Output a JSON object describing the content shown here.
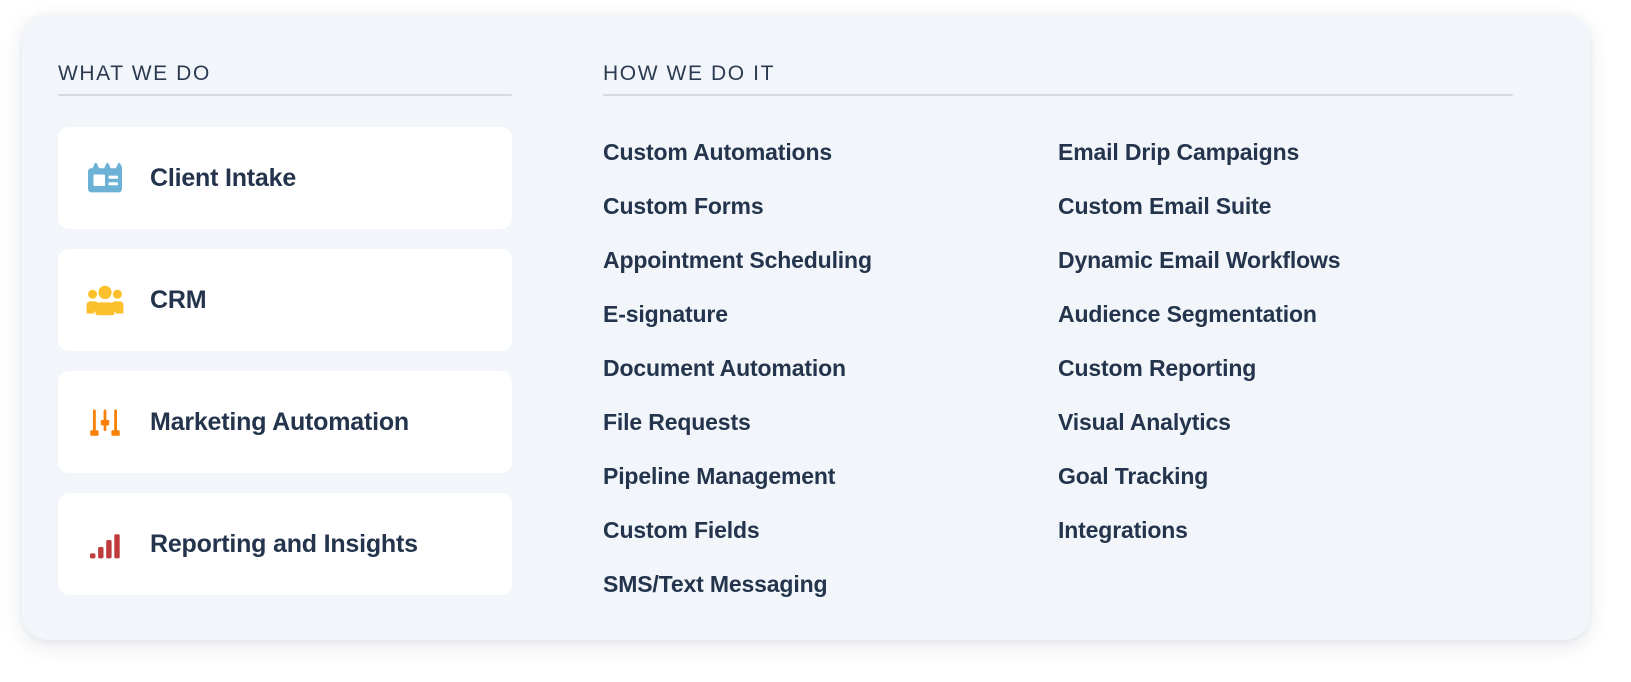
{
  "panel": {
    "background_color": "#f2f6fa",
    "card_color": "#ffffff",
    "text_color": "#23344c",
    "rule_color": "#d3dae2"
  },
  "left_column": {
    "heading": "WHAT WE DO",
    "items": [
      {
        "label": "Client Intake",
        "icon": "id-card-icon",
        "icon_color": "#6cb2d6"
      },
      {
        "label": "CRM",
        "icon": "people-group-icon",
        "icon_color": "#fbc02a"
      },
      {
        "label": "Marketing Automation",
        "icon": "sliders-icon",
        "icon_color": "#f98006"
      },
      {
        "label": "Reporting and Insights",
        "icon": "bar-chart-icon",
        "icon_color": "#c03c3c"
      }
    ]
  },
  "right_column": {
    "heading": "HOW WE DO IT",
    "columns": [
      {
        "items": [
          "Custom Automations",
          "Custom Forms",
          "Appointment Scheduling",
          "E-signature",
          "Document Automation",
          "File Requests",
          "Pipeline Management",
          "Custom Fields",
          "SMS/Text Messaging"
        ]
      },
      {
        "items": [
          "Email Drip Campaigns",
          "Custom Email Suite",
          "Dynamic Email Workflows",
          "Audience Segmentation",
          "Custom Reporting",
          "Visual Analytics",
          "Goal Tracking",
          "Integrations"
        ]
      }
    ]
  }
}
